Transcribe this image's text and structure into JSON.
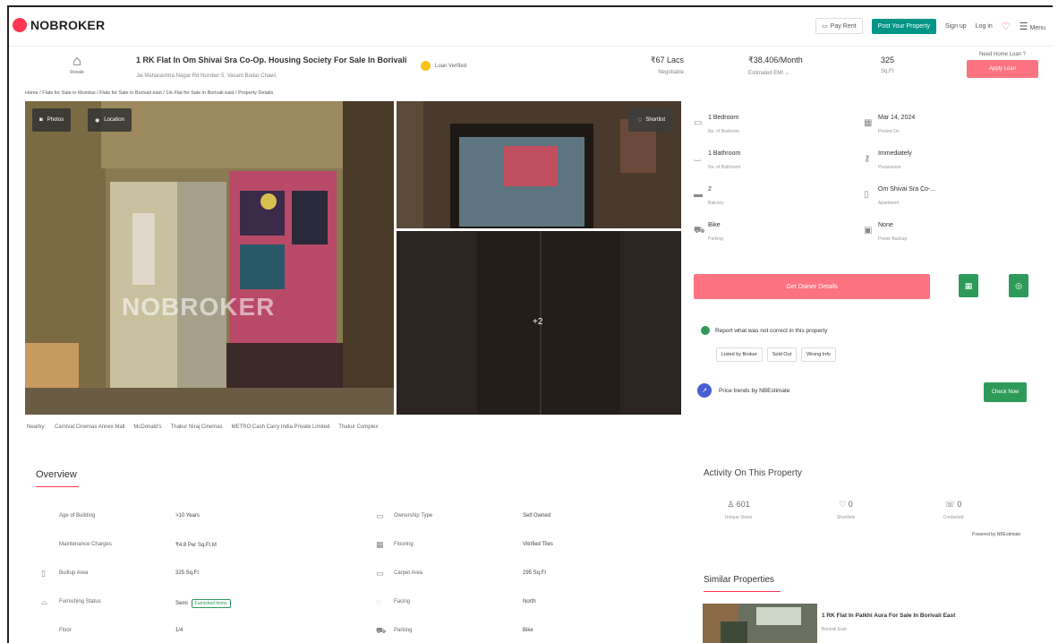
{
  "header": {
    "logo_text": "NOBROKER",
    "pay_rent": "Pay Rent",
    "post_property": "Post Your Property",
    "sign_up": "Sign up",
    "log_in": "Log in",
    "menu": "Menu"
  },
  "property": {
    "type_label": "Resale",
    "title": "1 RK Flat In Om Shivai Sra Co-Op. Housing Society For Sale In Borivali",
    "address": "Jai Maharashtra Nagar Rd Number 5, Vasant Bodar Chawl,",
    "verified_label": "Loan Verified",
    "price": "₹67 Lacs",
    "price_sub": "Negotiable",
    "emi": "₹38,406/Month",
    "emi_sub": "Estimated EMI",
    "area": "325",
    "area_unit": "Sq.Ft",
    "loan_question": "Need Home Loan ?",
    "apply_loan": "Apply Loan"
  },
  "breadcrumb": "Home / Flats for Sale in Mumbai / Flats for Sale in Borivali east / 1rk Flat for Sale in Borivali east / Property Details",
  "gallery": {
    "photos": "Photos",
    "location": "Location",
    "shortlist": "Shortlist",
    "watermark": "NOBROKER",
    "more": "+2"
  },
  "nearby": {
    "label": "Nearby:",
    "places": [
      "Carnival Cinemas Annex Mall",
      "McDonald's",
      "Thakur Niraj Cinemas",
      "METRO Cash Carry India Private Limited",
      "Thakur Complex"
    ]
  },
  "details": [
    {
      "value": "1 Bedroom",
      "label": "No. of Bedroom"
    },
    {
      "value": "Mar 14, 2024",
      "label": "Posted On"
    },
    {
      "value": "1 Bathroom",
      "label": "No. of Bathroom"
    },
    {
      "value": "Immediately",
      "label": "Possession"
    },
    {
      "value": "2",
      "label": "Balcony"
    },
    {
      "value": "Om Shivai Sra Co-...",
      "label": "Apartment"
    },
    {
      "value": "Bike",
      "label": "Parking"
    },
    {
      "value": "None",
      "label": "Power Backup"
    }
  ],
  "actions": {
    "get_owner": "Get Owner Details",
    "report": "Report what was not correct in this property",
    "report_options": [
      "Listed by Broker",
      "Sold Out",
      "Wrong Info"
    ],
    "trend": "Price trends by NBEstimate",
    "check_now": "Check Now"
  },
  "overview": {
    "title": "Overview",
    "rows": [
      {
        "label": "Age of Building",
        "value": ">10 Years"
      },
      {
        "label": "Ownership Type",
        "value": "Self Owned"
      },
      {
        "label": "Maintenance Charges",
        "value": "₹4.8 Per Sq.Ft.M"
      },
      {
        "label": "Flooring",
        "value": "Vitrified Tiles"
      },
      {
        "label": "Builtup Area",
        "value": "325 Sq.Ft"
      },
      {
        "label": "Carpet Area",
        "value": "295 Sq.Ft"
      },
      {
        "label": "Furnishing Status",
        "value": "Semi",
        "badge": "Furnished Items"
      },
      {
        "label": "Facing",
        "value": "North"
      },
      {
        "label": "Floor",
        "value": "1/4"
      },
      {
        "label": "Parking",
        "value": "Bike"
      }
    ]
  },
  "activity": {
    "title": "Activity On This Property",
    "views": "601",
    "views_label": "Unique Views",
    "shortlists": "0",
    "shortlists_label": "Shortlists",
    "contacted": "0",
    "contacted_label": "Contacted",
    "powered": "Powered by NBEstimate"
  },
  "similar": {
    "title": "Similar Properties",
    "name": "1 RK Flat In Palkhi Aura For Sale In Borivali East",
    "sub": "Borivali East"
  }
}
